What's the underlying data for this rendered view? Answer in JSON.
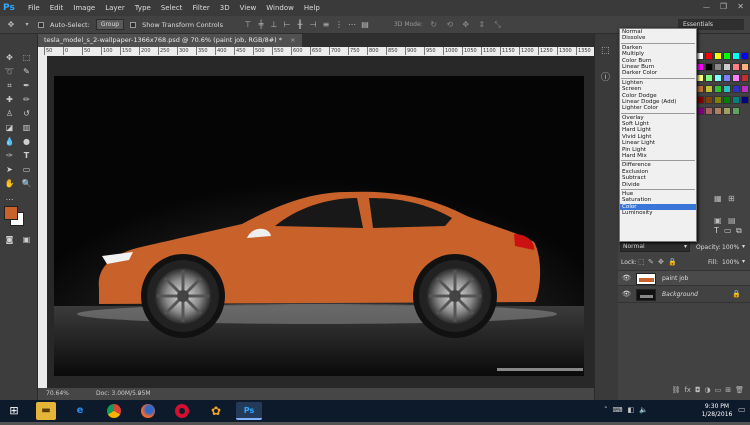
{
  "app": {
    "logo": "Ps"
  },
  "menubar": [
    "File",
    "Edit",
    "Image",
    "Layer",
    "Type",
    "Select",
    "Filter",
    "3D",
    "View",
    "Window",
    "Help"
  ],
  "options": {
    "auto_select": "Auto-Select:",
    "group": "Group",
    "transform": "Show Transform Controls",
    "mode3d": "3D Mode:",
    "workspace": "Essentials"
  },
  "document": {
    "tab_title": "tesla_model_s_2-wallpaper-1366x768.psd @ 70.6% (paint job, RGB/8#) *",
    "zoom": "70.64%",
    "doc_size": "Doc: 3.00M/5.95M"
  },
  "ruler_ticks": [
    "50",
    "0",
    "50",
    "100",
    "150",
    "200",
    "250",
    "300",
    "350",
    "400",
    "450",
    "500",
    "550",
    "600",
    "650",
    "700",
    "750",
    "800",
    "850",
    "900",
    "950",
    "1000",
    "1050",
    "1100",
    "1150",
    "1200",
    "1250",
    "1300",
    "1350"
  ],
  "blend_modes": {
    "groups": [
      [
        "Normal",
        "Dissolve"
      ],
      [
        "Darken",
        "Multiply",
        "Color Burn",
        "Linear Burn",
        "Darker Color"
      ],
      [
        "Lighten",
        "Screen",
        "Color Dodge",
        "Linear Dodge (Add)",
        "Lighter Color"
      ],
      [
        "Overlay",
        "Soft Light",
        "Hard Light",
        "Vivid Light",
        "Linear Light",
        "Pin Light",
        "Hard Mix"
      ],
      [
        "Difference",
        "Exclusion",
        "Subtract",
        "Divide"
      ],
      [
        "Hue",
        "Saturation",
        "Color",
        "Luminosity"
      ]
    ],
    "selected": "Color"
  },
  "layers_panel": {
    "mode": "Normal",
    "opacity_label": "Opacity:",
    "opacity": "100%",
    "lock_label": "Lock:",
    "fill_label": "Fill:",
    "fill": "100%",
    "layers": [
      {
        "name": "paint job",
        "visible": true,
        "selected": false
      },
      {
        "name": "Background",
        "visible": true,
        "locked": true
      }
    ]
  },
  "taskbar": {
    "time": "9:30 PM",
    "date": "1/28/2016",
    "apps": [
      "file-explorer",
      "internet-explorer",
      "chrome",
      "firefox",
      "opera",
      "app-flower",
      "photoshop"
    ]
  },
  "colors": {
    "accent": "#31a8ff",
    "car_paint": "#c8622a",
    "foreground": "#c8622a",
    "background": "#ffffff"
  }
}
